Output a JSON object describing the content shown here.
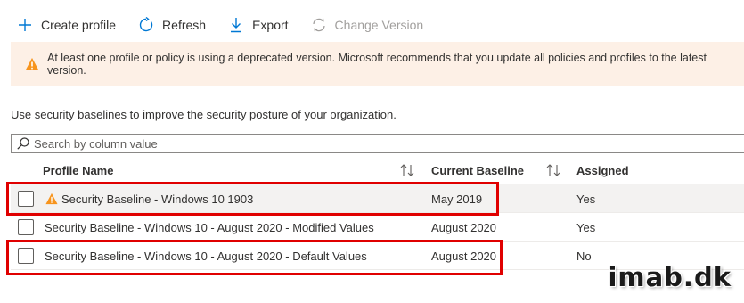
{
  "toolbar": {
    "create_label": "Create profile",
    "refresh_label": "Refresh",
    "export_label": "Export",
    "change_version_label": "Change Version"
  },
  "banner": {
    "text": "At least one profile or policy is using a deprecated version. Microsoft recommends that you update all policies and profiles to the latest version."
  },
  "intro": "Use security baselines to improve the security posture of your organization.",
  "search": {
    "placeholder": "Search by column value"
  },
  "table": {
    "headers": {
      "profile_name": "Profile Name",
      "current_baseline": "Current Baseline",
      "assigned": "Assigned"
    },
    "rows": [
      {
        "name": "Security Baseline - Windows 10 1903",
        "baseline": "May 2019",
        "assigned": "Yes",
        "warning": true,
        "highlighted": true,
        "selected": true
      },
      {
        "name": "Security Baseline - Windows 10 - August 2020 - Modified Values",
        "baseline": "August 2020",
        "assigned": "Yes",
        "warning": false,
        "highlighted": false,
        "selected": false
      },
      {
        "name": "Security Baseline - Windows 10 - August 2020 - Default Values",
        "baseline": "August 2020",
        "assigned": "No",
        "warning": false,
        "highlighted": true,
        "selected": false
      }
    ]
  },
  "watermark": "imab.dk",
  "colors": {
    "accent": "#0078d4",
    "warning": "#f7941d",
    "highlight": "#e00000",
    "banner_bg": "#fdf0e6"
  }
}
